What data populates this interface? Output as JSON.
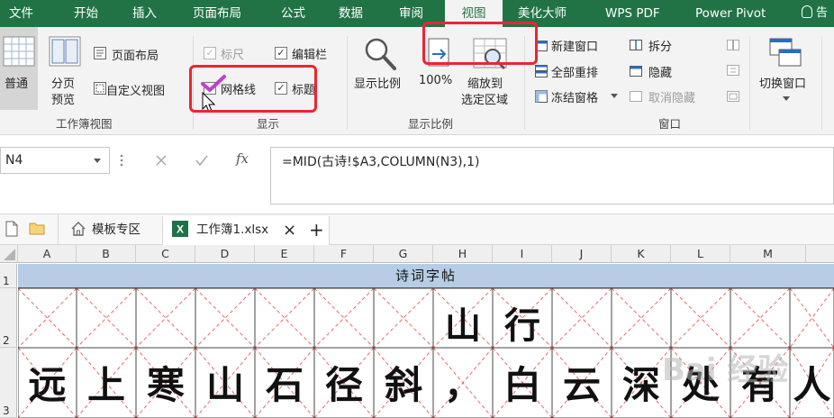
{
  "ribbon_tabs": [
    "文件",
    "开始",
    "插入",
    "页面布局",
    "公式",
    "数据",
    "审阅",
    "视图",
    "美化大师",
    "WPS PDF",
    "Power Pivot"
  ],
  "tab_search": "告",
  "groups": {
    "workbook_views": {
      "label": "工作簿视图",
      "normal": "普通",
      "page_break_1": "分页",
      "page_break_2": "预览",
      "page_layout": "页面布局",
      "custom_views": "自定义视图"
    },
    "show": {
      "label": "显示",
      "ruler": "标尺",
      "formula_bar": "编辑栏",
      "gridlines": "网格线",
      "headings": "标题"
    },
    "zoom": {
      "label": "显示比例",
      "zoom": "显示比例",
      "zoom_100": "100%",
      "zoom_sel_1": "缩放到",
      "zoom_sel_2": "选定区域"
    },
    "window": {
      "label": "窗口",
      "new_window": "新建窗口",
      "arrange_all": "全部重排",
      "freeze_panes": "冻结窗格",
      "split": "拆分",
      "hide": "隐藏",
      "unhide": "取消隐藏",
      "switch_windows": "切换窗口"
    }
  },
  "formula_bar": {
    "name_box": "N4",
    "fx": "fx",
    "formula": "=MID(古诗!$A3,COLUMN(N3),1)"
  },
  "doc_tabs": {
    "template": "模板专区",
    "workbook": "工作簿1.xlsx",
    "close": "×",
    "add": "+"
  },
  "columns": [
    "A",
    "B",
    "C",
    "D",
    "E",
    "F",
    "G",
    "H",
    "I",
    "J",
    "K",
    "L",
    "M"
  ],
  "rows": [
    "1",
    "2",
    "3"
  ],
  "sheet": {
    "title": "诗词字帖",
    "row2": [
      "山",
      "行"
    ],
    "row3": [
      "远",
      "上",
      "寒",
      "山",
      "石",
      "径",
      "斜",
      "，",
      "白",
      "云",
      "深",
      "处",
      "有",
      "人"
    ]
  },
  "watermark": "Bai 经验"
}
